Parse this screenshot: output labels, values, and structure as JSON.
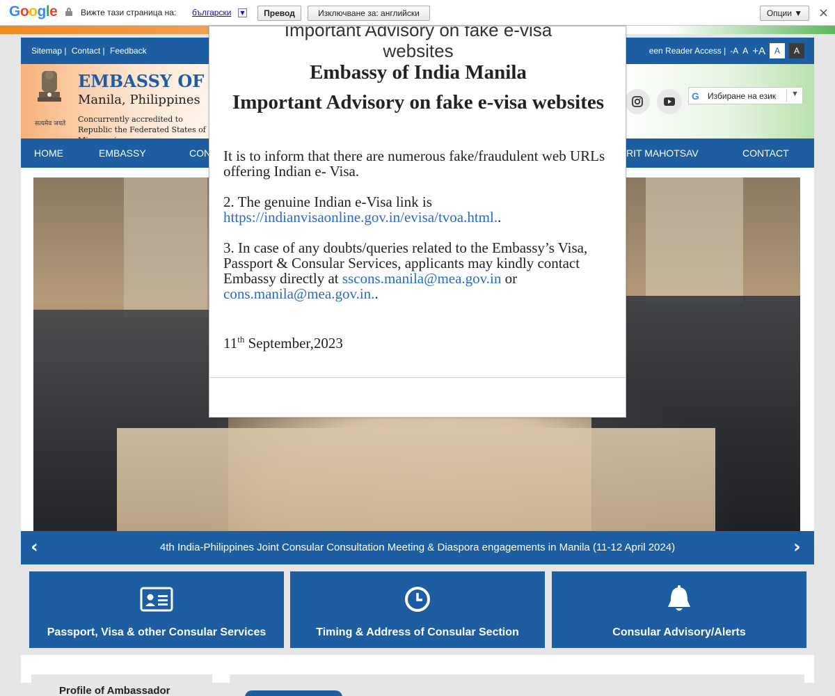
{
  "translate_bar": {
    "logo": "Google",
    "view_text": "Вижте тази страница на:",
    "language": "български",
    "translate_button": "Превод",
    "never_button": "Изключване за: английски",
    "options_button": "Опции ▼",
    "close": "×"
  },
  "utility": {
    "links": [
      "Sitemap |",
      "Contact |",
      "Feedback"
    ],
    "screen_reader": "een Reader Access |",
    "font_small": "-A",
    "font_normal": "A",
    "font_large": "+A",
    "contrast_light": "A",
    "contrast_dark": "A"
  },
  "header": {
    "title": "EMBASSY OF",
    "subtitle": "Manila, Philippines",
    "note": "Concurrently accredited to Republic the Federated States of Micronesia",
    "emblem_hindi": "सत्यमेव जयते",
    "language_selector": "Избиране на език"
  },
  "nav": {
    "items": [
      "HOME",
      "EMBASSY",
      "CON",
      "RIT MAHOTSAV",
      "CONTACT"
    ]
  },
  "slider": {
    "caption": "4th India-Philippines Joint Consular Consultation Meeting & Diaspora engagements in Manila (11-12 April 2024)",
    "prev": "‹",
    "next": "›"
  },
  "tiles": [
    {
      "label": "Passport, Visa & other Consular Services",
      "icon": "id-card-icon"
    },
    {
      "label": "Timing & Address of Consular Section",
      "icon": "clock-icon"
    },
    {
      "label": "Consular Advisory/Alerts",
      "icon": "bell-icon"
    }
  ],
  "lower": {
    "profile_title": "Profile of Ambassador"
  },
  "modal": {
    "cut_title_line1": "Important Advisory on fake e-visa",
    "cut_title_line2": "websites",
    "heading1": "Embassy of India Manila",
    "heading2": "Important Advisory on fake e-visa websites",
    "para1": " It is to inform that there are numerous fake/fraudulent web URLs offering Indian e- Visa.",
    "para2_prefix": "2. The genuine Indian e-Visa link is ",
    "para2_link": "https://indianvisaonline.gov.in/evisa/tvoa.html.",
    "para2_suffix": ".",
    "para3_prefix": "3. In case of any doubts/queries related to the Embassy’s Visa, Passport & Consular Services, applicants may kindly contact Embassy directly at ",
    "para3_link1": "sscons.manila@mea.gov.in",
    "para3_mid": " or ",
    "para3_link2": "cons.manila@mea.gov.in.",
    "para3_suffix": ".",
    "date_day": "11",
    "date_sup": "th",
    "date_rest": " September,2023"
  },
  "colors": {
    "primary": "#1d5ea3",
    "link": "#2a6bc4"
  }
}
